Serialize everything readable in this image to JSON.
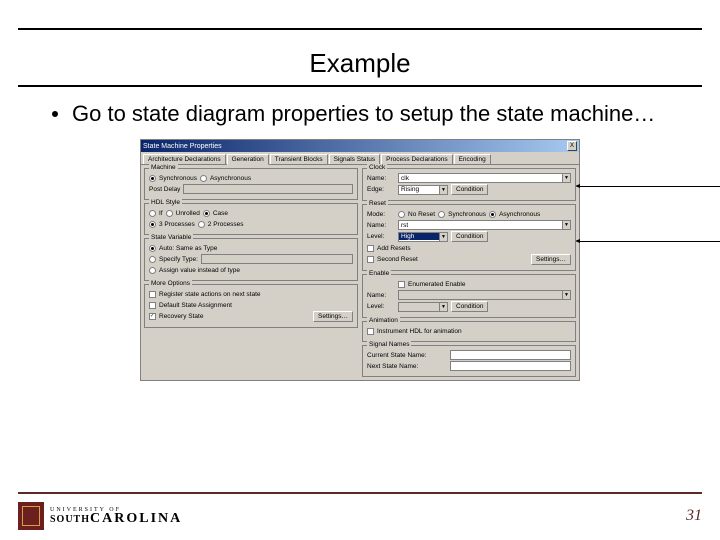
{
  "slide": {
    "title": "Example",
    "bullet": "Go to state diagram properties to setup the state machine…",
    "page_num": "31",
    "university": {
      "small": "UNIVERSITY OF",
      "south": "SOUTH",
      "carolina": "CAROLINA"
    }
  },
  "dialog": {
    "title": "State Machine Properties",
    "close": "X",
    "tabs": [
      "Architecture Declarations",
      "Generation",
      "Transient Blocks",
      "Signals Status",
      "Process Declarations",
      "Encoding"
    ],
    "active_tab": 1,
    "left": {
      "machine": {
        "title": "Machine",
        "opts": [
          "Synchronous",
          "Asynchronous"
        ],
        "post_delay": "Post Delay"
      },
      "hdl_style": {
        "title": "HDL Style",
        "row1": [
          "If",
          "Unrolled",
          "Case"
        ],
        "row2": [
          "3 Processes",
          "2 Processes"
        ]
      },
      "state_var": {
        "title": "State Variable",
        "auto": "Auto: Same as Type",
        "specify_type": "Specify Type:",
        "assign_value": "Assign value instead of type"
      },
      "more": {
        "title": "More Options",
        "reg": "Register state actions on next state",
        "dsa": "Default State Assignment",
        "rs": "Recovery State",
        "settings": "Settings…"
      }
    },
    "right": {
      "clock": {
        "title": "Clock",
        "name": "Name:",
        "name_val": "clk",
        "edge": "Edge:",
        "edge_val": "Rising",
        "cond": "Condition"
      },
      "reset": {
        "title": "Reset",
        "mode": "Mode:",
        "opts": [
          "No Reset",
          "Synchronous",
          "Asynchronous"
        ],
        "name": "Name:",
        "name_val": "rst",
        "level": "Level:",
        "level_val": "High",
        "cond": "Condition",
        "add": "Add Resets",
        "second": "Second Reset",
        "settings": "Settings…"
      },
      "enable": {
        "title": "Enable",
        "enum": "Enumerated Enable",
        "name": "Name:",
        "level": "Level:",
        "cond": "Condition"
      },
      "anim": {
        "title": "Animation",
        "inst": "Instrument HDL for animation"
      },
      "signames": {
        "title": "Signal Names",
        "cur": "Current State Name:",
        "next": "Next State Name:"
      }
    }
  }
}
